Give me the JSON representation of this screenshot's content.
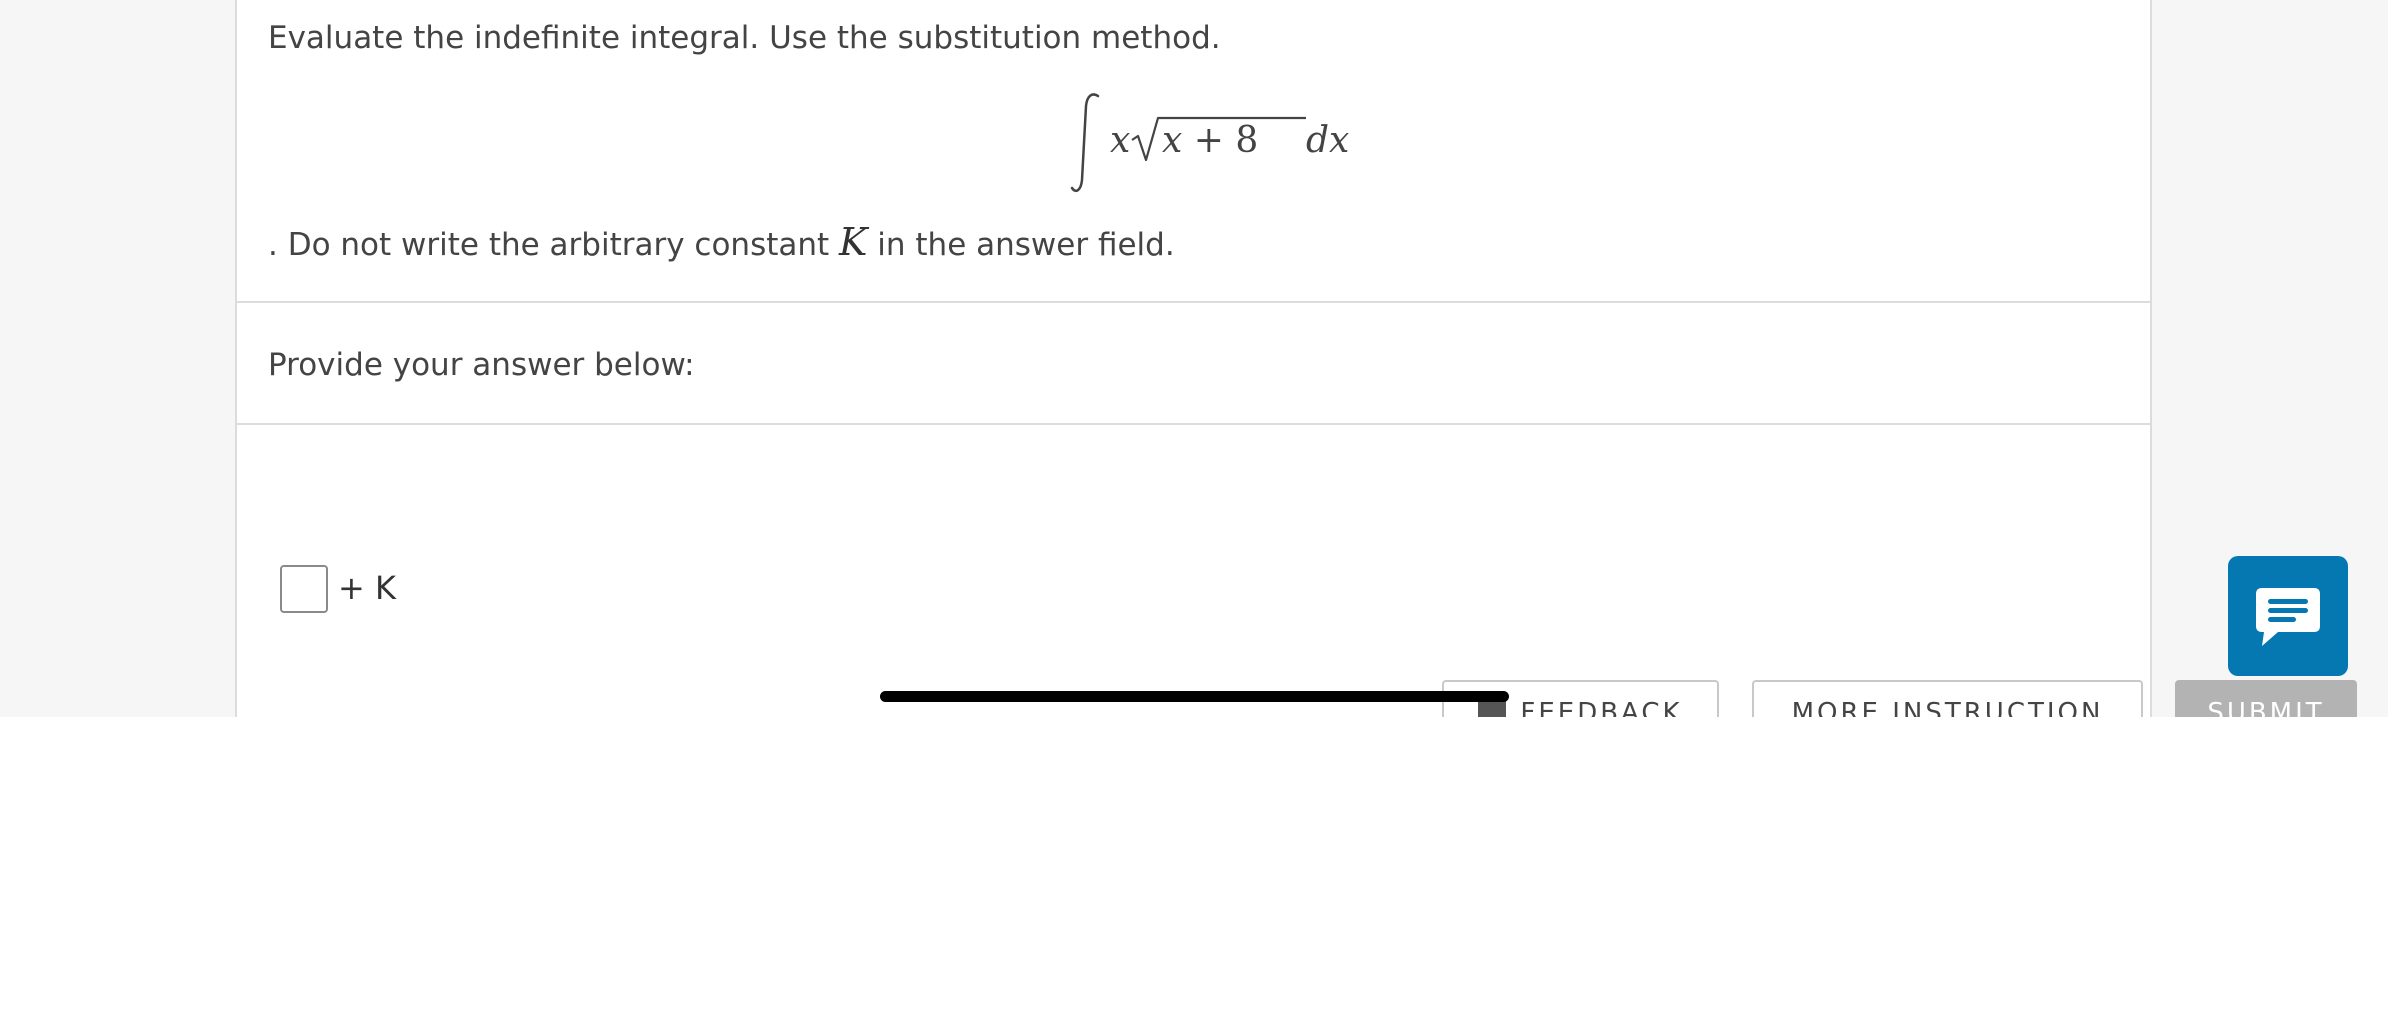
{
  "question": {
    "intro": "Evaluate the indefinite integral. Use the substitution method.",
    "integral_latex": "\\int x\\sqrt{x+8}dx",
    "outro_before": ". Do not write the arbitrary constant ",
    "outro_constant": "K",
    "outro_after": " in the answer field."
  },
  "prompt": {
    "text": "Provide your answer below:"
  },
  "answer": {
    "value": "",
    "suffix": "+ K"
  },
  "buttons": {
    "feedback_label": "FEEDBACK",
    "more_instruction_label": "MORE INSTRUCTION",
    "submit_label": "SUBMIT"
  },
  "icons": {
    "chat": "chat-bubble-icon",
    "feedback": "feedback-icon"
  },
  "colors": {
    "chat_button": "#0678b1",
    "submit_disabled": "#b3b3b3"
  }
}
